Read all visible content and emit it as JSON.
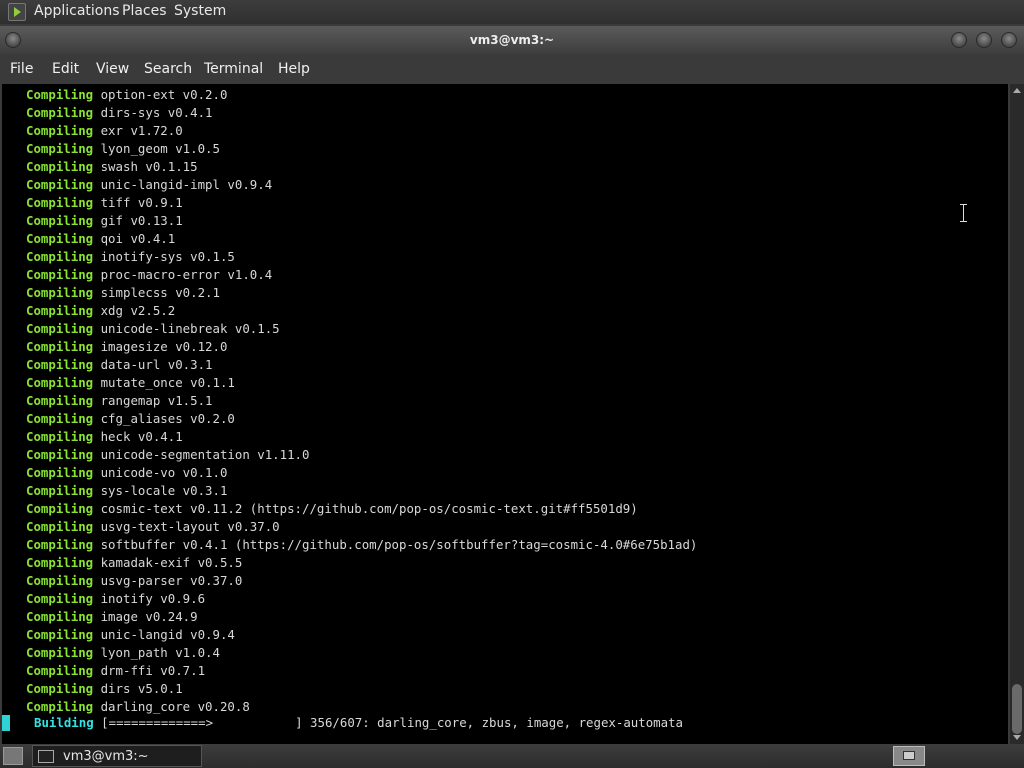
{
  "top_panel": {
    "menus": [
      "Applications",
      "Places",
      "System"
    ]
  },
  "window": {
    "title": "vm3@vm3:~",
    "menubar": [
      "File",
      "Edit",
      "View",
      "Search",
      "Terminal",
      "Help"
    ]
  },
  "terminal": {
    "lines": [
      {
        "kw": "Compiling",
        "text": " option-ext v0.2.0"
      },
      {
        "kw": "Compiling",
        "text": " dirs-sys v0.4.1"
      },
      {
        "kw": "Compiling",
        "text": " exr v1.72.0"
      },
      {
        "kw": "Compiling",
        "text": " lyon_geom v1.0.5"
      },
      {
        "kw": "Compiling",
        "text": " swash v0.1.15"
      },
      {
        "kw": "Compiling",
        "text": " unic-langid-impl v0.9.4"
      },
      {
        "kw": "Compiling",
        "text": " tiff v0.9.1"
      },
      {
        "kw": "Compiling",
        "text": " gif v0.13.1"
      },
      {
        "kw": "Compiling",
        "text": " qoi v0.4.1"
      },
      {
        "kw": "Compiling",
        "text": " inotify-sys v0.1.5"
      },
      {
        "kw": "Compiling",
        "text": " proc-macro-error v1.0.4"
      },
      {
        "kw": "Compiling",
        "text": " simplecss v0.2.1"
      },
      {
        "kw": "Compiling",
        "text": " xdg v2.5.2"
      },
      {
        "kw": "Compiling",
        "text": " unicode-linebreak v0.1.5"
      },
      {
        "kw": "Compiling",
        "text": " imagesize v0.12.0"
      },
      {
        "kw": "Compiling",
        "text": " data-url v0.3.1"
      },
      {
        "kw": "Compiling",
        "text": " mutate_once v0.1.1"
      },
      {
        "kw": "Compiling",
        "text": " rangemap v1.5.1"
      },
      {
        "kw": "Compiling",
        "text": " cfg_aliases v0.2.0"
      },
      {
        "kw": "Compiling",
        "text": " heck v0.4.1"
      },
      {
        "kw": "Compiling",
        "text": " unicode-segmentation v1.11.0"
      },
      {
        "kw": "Compiling",
        "text": " unicode-vo v0.1.0"
      },
      {
        "kw": "Compiling",
        "text": " sys-locale v0.3.1"
      },
      {
        "kw": "Compiling",
        "text": " cosmic-text v0.11.2 (https://github.com/pop-os/cosmic-text.git#ff5501d9)"
      },
      {
        "kw": "Compiling",
        "text": " usvg-text-layout v0.37.0"
      },
      {
        "kw": "Compiling",
        "text": " softbuffer v0.4.1 (https://github.com/pop-os/softbuffer?tag=cosmic-4.0#6e75b1ad)"
      },
      {
        "kw": "Compiling",
        "text": " kamadak-exif v0.5.5"
      },
      {
        "kw": "Compiling",
        "text": " usvg-parser v0.37.0"
      },
      {
        "kw": "Compiling",
        "text": " inotify v0.9.6"
      },
      {
        "kw": "Compiling",
        "text": " image v0.24.9"
      },
      {
        "kw": "Compiling",
        "text": " unic-langid v0.9.4"
      },
      {
        "kw": "Compiling",
        "text": " lyon_path v1.0.4"
      },
      {
        "kw": "Compiling",
        "text": " drm-ffi v0.7.1"
      },
      {
        "kw": "Compiling",
        "text": " dirs v5.0.1"
      },
      {
        "kw": "Compiling",
        "text": " darling_core v0.20.8"
      }
    ],
    "building": {
      "kw": "Building",
      "text": " [=============>           ] 356/607: darling_core, zbus, image, regex-automata",
      "done": 356,
      "total": 607
    },
    "colors": {
      "compiling": "#8ae234",
      "building": "#34e2e2",
      "text": "#d8d8d8",
      "background": "#000000"
    }
  },
  "taskbar": {
    "task_label": "vm3@vm3:~"
  },
  "icons": [
    "app-menu-icon",
    "window-menu-icon",
    "minimize-icon",
    "maximize-icon",
    "close-icon",
    "show-desktop-icon",
    "terminal-icon",
    "workspace-switcher-icon",
    "text-cursor-icon"
  ]
}
